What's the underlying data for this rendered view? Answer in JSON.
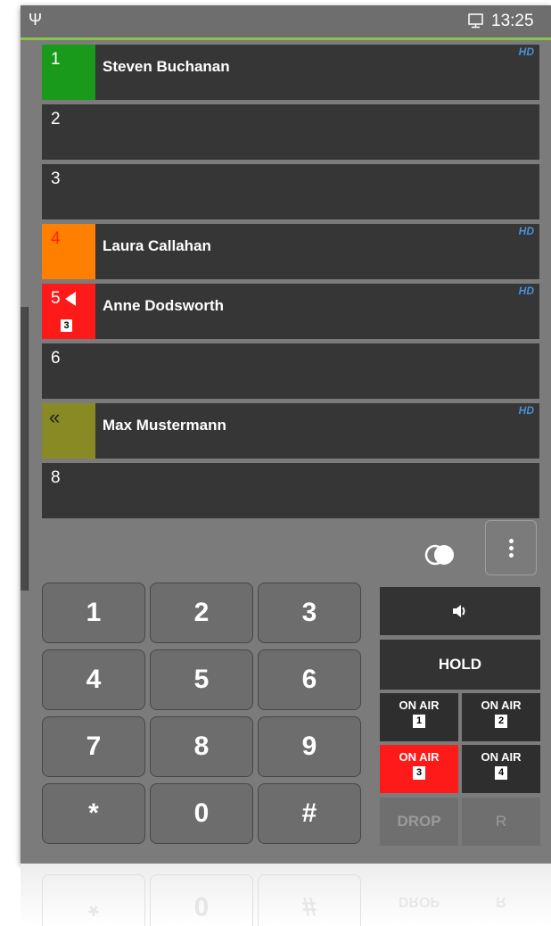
{
  "status_bar": {
    "clock": "13:25",
    "usb_icon": "usb-icon",
    "screen_icon": "screen-icon",
    "accent_color": "#8bc34a"
  },
  "lines": [
    {
      "num": "1",
      "name": "Steven Buchanan",
      "hd": "HD",
      "color": "#1a9a1a"
    },
    {
      "num": "2",
      "name": "",
      "hd": ""
    },
    {
      "num": "3",
      "name": "",
      "hd": ""
    },
    {
      "num": "4",
      "name": "Laura Callahan",
      "hd": "HD",
      "color": "#ff7f00",
      "num_color": "#ff2200"
    },
    {
      "num": "5",
      "name": "Anne Dodsworth",
      "hd": "HD",
      "color": "#ff1a1a",
      "badge": "3",
      "icon": "arrow-left-icon"
    },
    {
      "num": "6",
      "name": "",
      "hd": ""
    },
    {
      "num": "",
      "name": "Max Mustermann",
      "hd": "HD",
      "color": "#8a8a24",
      "icon": "double-chevron-left-icon"
    },
    {
      "num": "8",
      "name": "",
      "hd": ""
    }
  ],
  "keypad": [
    "1",
    "2",
    "3",
    "4",
    "5",
    "6",
    "7",
    "8",
    "9",
    "*",
    "0",
    "#"
  ],
  "controls": {
    "speaker_icon": "speaker-icon",
    "hold": "HOLD",
    "onair": [
      {
        "label": "ON AIR",
        "num": "1",
        "active": false
      },
      {
        "label": "ON AIR",
        "num": "2",
        "active": false
      },
      {
        "label": "ON AIR",
        "num": "3",
        "active": true,
        "color": "#ff1a1a"
      },
      {
        "label": "ON AIR",
        "num": "4",
        "active": false
      }
    ],
    "drop": "DROP",
    "r": "R",
    "toggle_icon": "toggle-circles-icon",
    "menu_icon": "more-vert-icon"
  },
  "reflection": {
    "keys": [
      "*",
      "0",
      "#"
    ],
    "buttons": [
      "DROP",
      "R"
    ]
  }
}
